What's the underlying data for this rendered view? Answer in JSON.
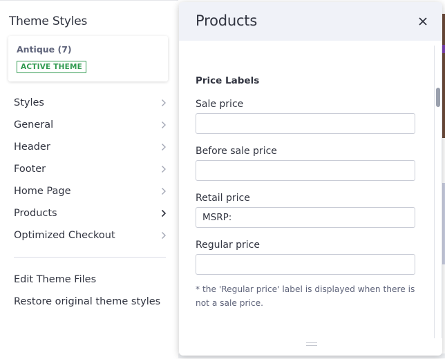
{
  "sidebar": {
    "title": "Theme Styles",
    "theme_card": {
      "name": "Antique (7)",
      "badge": "ACTIVE THEME"
    },
    "menu": [
      {
        "label": "Styles",
        "icon": "chevron-right-icon"
      },
      {
        "label": "General",
        "icon": "chevron-right-icon"
      },
      {
        "label": "Header",
        "icon": "chevron-right-icon"
      },
      {
        "label": "Footer",
        "icon": "chevron-right-icon"
      },
      {
        "label": "Home Page",
        "icon": "chevron-right-icon"
      },
      {
        "label": "Products",
        "icon": "chevron-right-icon"
      },
      {
        "label": "Optimized Checkout",
        "icon": "chevron-right-icon"
      }
    ],
    "utilities": [
      {
        "label": "Edit Theme Files"
      },
      {
        "label": "Restore original theme styles"
      }
    ]
  },
  "modal": {
    "title": "Products",
    "close_icon": "close-icon",
    "section_title": "Price Labels",
    "fields": [
      {
        "label": "Sale price",
        "value": ""
      },
      {
        "label": "Before sale price",
        "value": ""
      },
      {
        "label": "Retail price",
        "value": "MSRP:"
      },
      {
        "label": "Regular price",
        "value": ""
      }
    ],
    "help_text": "* the 'Regular price' label is displayed when there is not a sale price."
  },
  "colors": {
    "badge_green": "#2f9a4f",
    "header_bg": "#f0f2f8",
    "text": "#313440"
  }
}
